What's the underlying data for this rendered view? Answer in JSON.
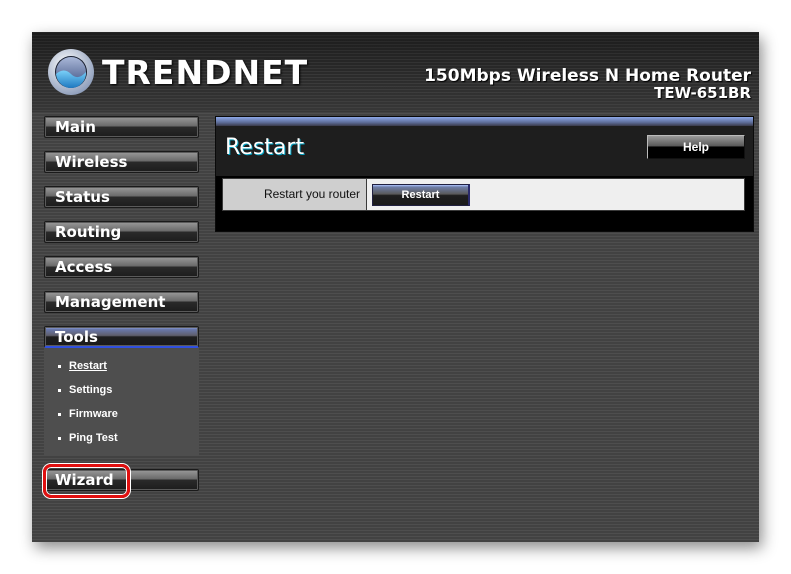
{
  "header": {
    "brand": "TRENDnet",
    "brand_display": "TRENDNET",
    "product_title": "150Mbps Wireless N Home Router",
    "product_model": "TEW-651BR"
  },
  "sidebar": {
    "items": [
      {
        "label": "Main",
        "active": false
      },
      {
        "label": "Wireless",
        "active": false
      },
      {
        "label": "Status",
        "active": false
      },
      {
        "label": "Routing",
        "active": false
      },
      {
        "label": "Access",
        "active": false
      },
      {
        "label": "Management",
        "active": false
      },
      {
        "label": "Tools",
        "active": true
      }
    ],
    "tools_submenu": [
      {
        "label": "Restart",
        "current": true
      },
      {
        "label": "Settings",
        "current": false
      },
      {
        "label": "Firmware",
        "current": false
      },
      {
        "label": "Ping Test",
        "current": false
      }
    ],
    "wizard": {
      "label": "Wizard",
      "highlighted": true,
      "highlight_color": "#e01010"
    }
  },
  "content": {
    "title": "Restart",
    "help_label": "Help",
    "form": {
      "label": "Restart you router",
      "button_label": "Restart"
    }
  },
  "colors": {
    "accent_blue": "#3050e0",
    "page_bg": "#4a4a4a",
    "panel_bg": "#1e1e1e"
  }
}
